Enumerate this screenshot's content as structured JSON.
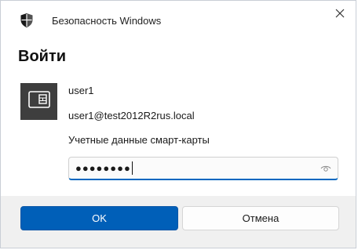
{
  "window": {
    "title": "Безопасность Windows",
    "app_icon": "shield-icon",
    "close_icon": "close-icon"
  },
  "dialog": {
    "heading": "Войти"
  },
  "credential": {
    "icon": "smart-card-icon",
    "username": "user1",
    "upn": "user1@test2012R2rus.local",
    "type_label": "Учетные данные смарт-карты"
  },
  "pin_field": {
    "value": "●●●●●●●●",
    "reveal_icon": "eye-icon"
  },
  "buttons": {
    "ok_label": "OK",
    "cancel_label": "Отмена"
  },
  "colors": {
    "accent": "#005fb8",
    "focus_border": "#0067c0",
    "tile": "#3e3e3e",
    "footer": "#f0f0f0"
  }
}
